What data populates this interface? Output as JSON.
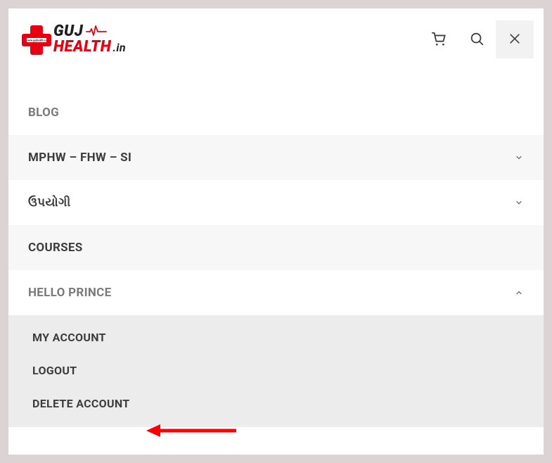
{
  "logo": {
    "top_text": "GUJ",
    "bottom_text1": "HEALTH",
    "bottom_text2": ".in"
  },
  "menu": {
    "blog": "BLOG",
    "mphw": "MPHW – FHW – SI",
    "useful": "ઉપયોગી",
    "courses": "COURSES",
    "hello": "HELLO PRINCE"
  },
  "submenu": {
    "my_account": "MY ACCOUNT",
    "logout": "LOGOUT",
    "delete_account": "DELETE ACCOUNT"
  }
}
